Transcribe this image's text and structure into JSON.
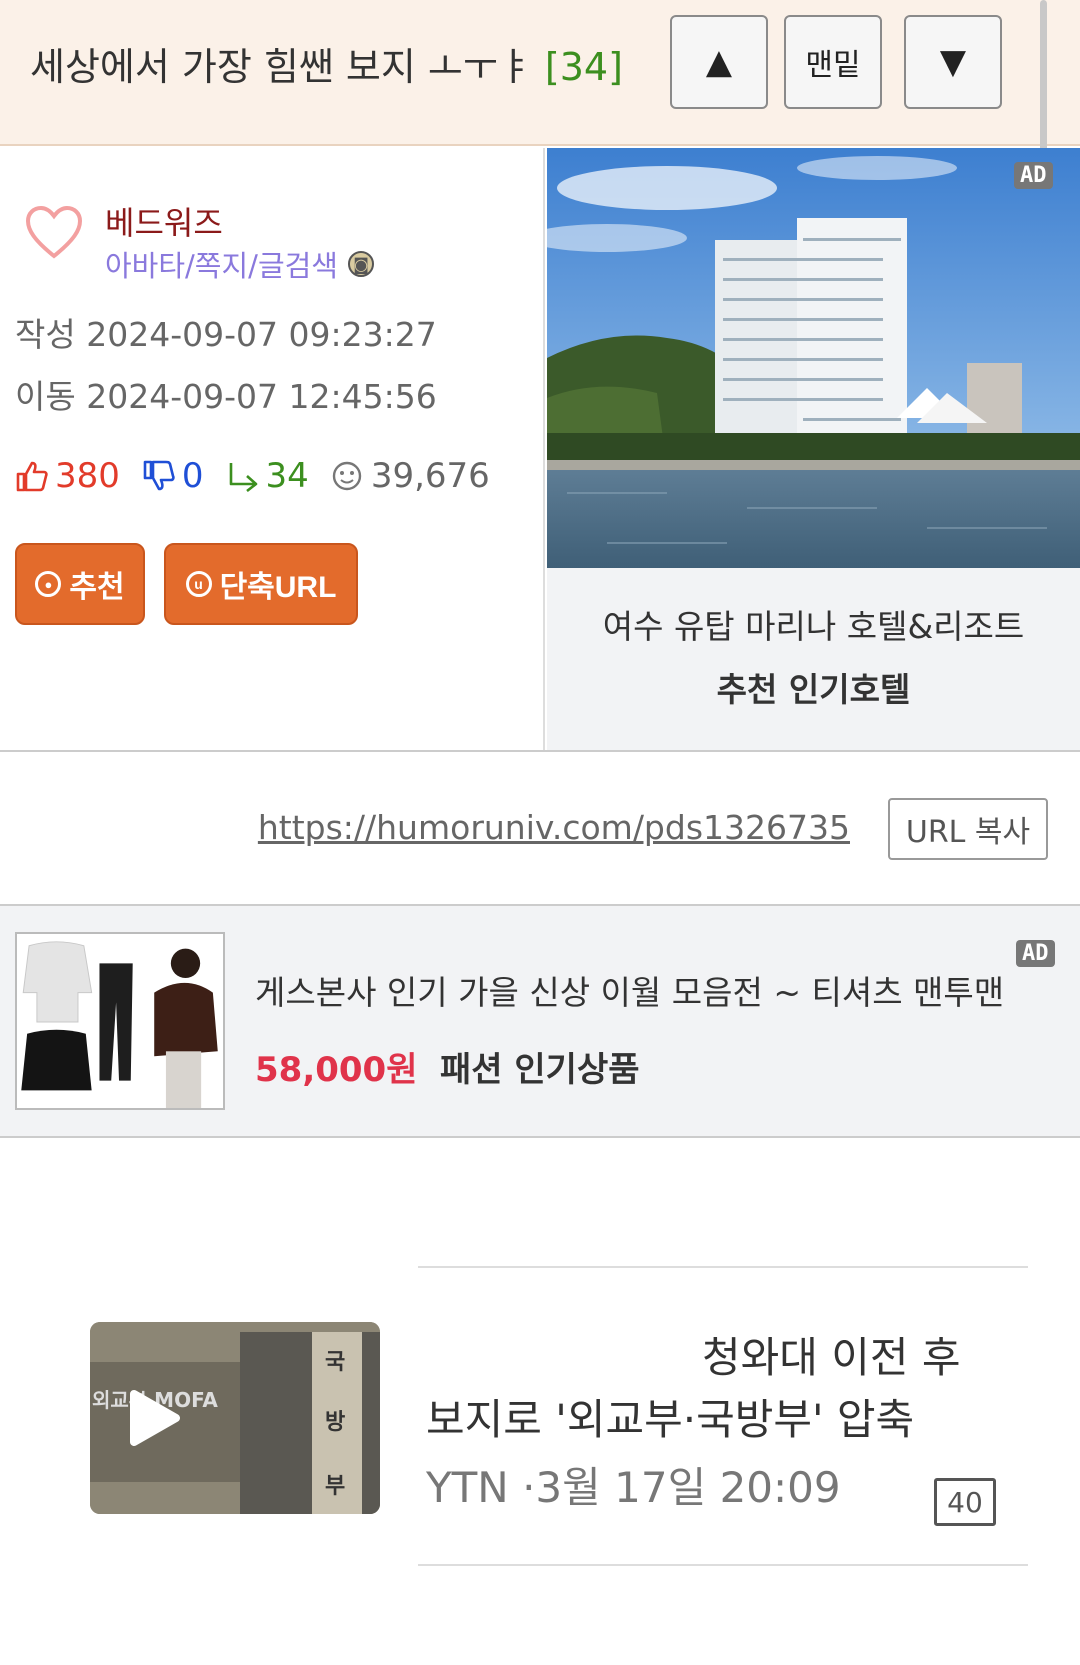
{
  "header": {
    "title": "세상에서 가장 힘쌘 보지 ㅗㅜㅑ",
    "comment_count": "[34]",
    "nav_up": "▲",
    "nav_bottom": "맨밑",
    "nav_down": "▼"
  },
  "author": {
    "nickname": "베드워즈",
    "links": "아바타/쪽지/글검색"
  },
  "post_meta": {
    "written": "작성 2024-09-07 09:23:27",
    "moved": "이동 2024-09-07 12:45:56"
  },
  "stats": {
    "likes": "380",
    "dislikes": "0",
    "replies": "34",
    "views": "39,676"
  },
  "actions": {
    "recommend": "추천",
    "short_url": "단축URL",
    "copy_url": "URL 복사"
  },
  "url": "https://humoruniv.com/pds1326735",
  "hotel_ad": {
    "tag": "AD",
    "name": "여수 유탑 마리나 호텔&리조트",
    "subtitle": "추천 인기호텔"
  },
  "shop_ad": {
    "tag": "AD",
    "title": "게스본사 인기 가을 신상 이월 모음전 ~ 티셔츠 맨투맨",
    "price": "58,000원",
    "category": "패션 인기상품"
  },
  "news": {
    "title_line1": "청와대 이전 후",
    "title_line2": "보지로 '외교부·국방부' 압축",
    "source_time": "YTN ·3월 17일 20:09",
    "comments": "40",
    "thumb_sign_chars": [
      "국",
      "방",
      "부"
    ],
    "thumb_building_text": "외교부 MOFA"
  }
}
